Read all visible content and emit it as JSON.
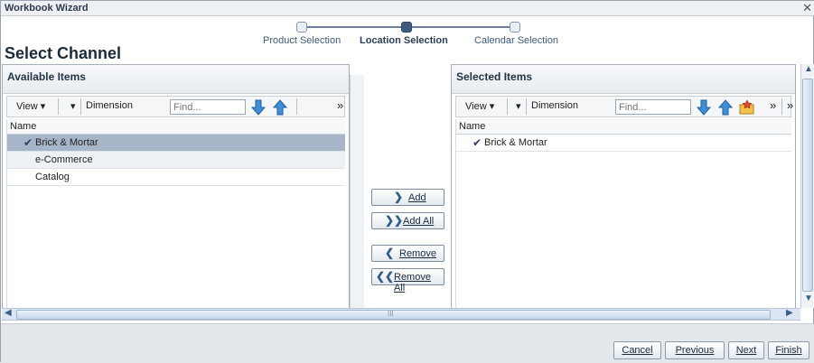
{
  "window": {
    "title": "Workbook Wizard",
    "close_glyph": "✕"
  },
  "train": {
    "stops": [
      {
        "label": "Product Selection"
      },
      {
        "label": "Location Selection"
      },
      {
        "label": "Calendar Selection"
      }
    ],
    "current_index": 1
  },
  "page_title": "Select Channel",
  "available": {
    "title": "Available Items",
    "toolbar": {
      "view_label": "View",
      "dimension_label": "Dimension",
      "find_placeholder": "Find...",
      "overflow": "»"
    },
    "column_header": "Name",
    "rows": [
      {
        "label": "Brick & Mortar",
        "checked": true,
        "selected": true
      },
      {
        "label": "e-Commerce",
        "checked": false,
        "selected": false
      },
      {
        "label": "Catalog",
        "checked": false,
        "selected": false
      }
    ]
  },
  "selected": {
    "title": "Selected Items",
    "toolbar": {
      "view_label": "View",
      "dimension_label": "Dimension",
      "find_placeholder": "Find...",
      "overflow": "»"
    },
    "column_header": "Name",
    "rows": [
      {
        "label": "Brick & Mortar",
        "checked": true
      }
    ]
  },
  "shuttle": {
    "add": "Add",
    "add_all": "Add All",
    "remove": "Remove",
    "remove_all": "Remove All"
  },
  "scrollbar": {
    "grip": "III"
  },
  "footer": {
    "cancel": "Cancel",
    "previous": "Previous",
    "next": "Next",
    "finish": "Finish"
  },
  "colors": {
    "accent": "#3e5a80",
    "selected_row": "#a7b5c9",
    "footer_bg": "#e3e8ec"
  }
}
